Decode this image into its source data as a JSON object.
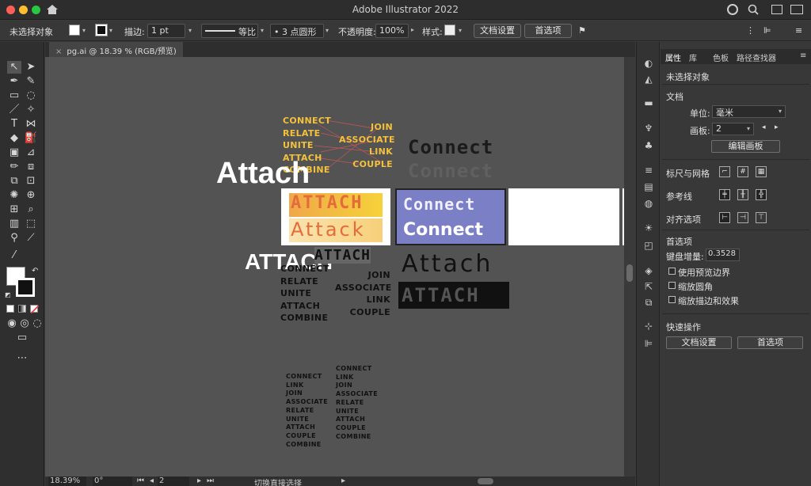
{
  "app": {
    "title": "Adobe Illustrator 2022"
  },
  "control_bar": {
    "selection_status": "未选择对象",
    "stroke_label": "描边:",
    "stroke_weight": "1 pt",
    "profile_label": "等比",
    "brush_label": "3 点圆形",
    "opacity_label": "不透明度:",
    "opacity_value": "100%",
    "style_label": "样式:",
    "doc_setup_button": "文档设置",
    "preferences_button": "首选项"
  },
  "document": {
    "tab_title": "pg.ai @ 18.39 % (RGB/预览)"
  },
  "artwork": {
    "big_attach": "Attach",
    "big_attach_caps": "ATTACH",
    "connect_pixel": "Connect",
    "connect_pixel_dim": "Connect",
    "attach_pixel": "ATTACH",
    "attach_outline": "Attach",
    "attach_bold": "ATTACH",
    "yellow_left": [
      "CONNECT",
      "RELATE",
      "UNITE",
      "ATTACH",
      "COMBINE"
    ],
    "yellow_right": [
      "JOIN",
      "ASSOCIATE",
      "LINK",
      "COUPLE"
    ],
    "black_left": [
      "CONNECT",
      "RELATE",
      "UNITE",
      "ATTACH",
      "COMBINE"
    ],
    "black_right": [
      "JOIN",
      "ASSOCIATE",
      "LINK",
      "COUPLE"
    ],
    "list_a": [
      "CONNECT",
      "LINK",
      "JOIN",
      "ASSOCIATE",
      "RELATE",
      "UNITE",
      "ATTACH",
      "COUPLE",
      "COMBINE"
    ],
    "list_b": [
      "CONNECT",
      "LINK",
      "JOIN",
      "ASSOCIATE",
      "RELATE",
      "UNITE",
      "ATTACH",
      "COUPLE",
      "COMBINE"
    ],
    "card2_top": "Connect",
    "card2_bottom": "Connect",
    "card1_top": "ATTACH",
    "card1_bottom": "Attack",
    "mini_pixel": "ATTACH"
  },
  "status_bar": {
    "zoom": "18.39%",
    "rotation": "0°",
    "artboard": "2",
    "tool_hint": "切换直接选择"
  },
  "properties_panel": {
    "tabs": [
      "属性",
      "库",
      "色板",
      "路径查找器"
    ],
    "selection_status": "未选择对象",
    "doc_section": "文档",
    "unit_label": "单位:",
    "unit_value": "毫米",
    "artboard_label": "画板:",
    "artboard_value": "2",
    "edit_artboards_button": "编辑画板",
    "rulers_grids_label": "标尺与网格",
    "guides_label": "参考线",
    "snap_label": "对齐选项",
    "preferences_section": "首选项",
    "keyboard_increment_label": "键盘增量:",
    "keyboard_increment_value": "0.3528 m",
    "checkbox_preview_bounds": "使用预览边界",
    "checkbox_scale_corners": "缩放圆角",
    "checkbox_scale_strokes": "缩放描边和效果",
    "quick_actions_section": "快速操作",
    "doc_setup_button": "文档设置",
    "preferences_button": "首选项"
  },
  "colors": {
    "canvas": "#535353",
    "ui_dark": "#2f2f2f",
    "accent_yellow": "#f3c13a",
    "card_blue": "#6f73b8"
  }
}
